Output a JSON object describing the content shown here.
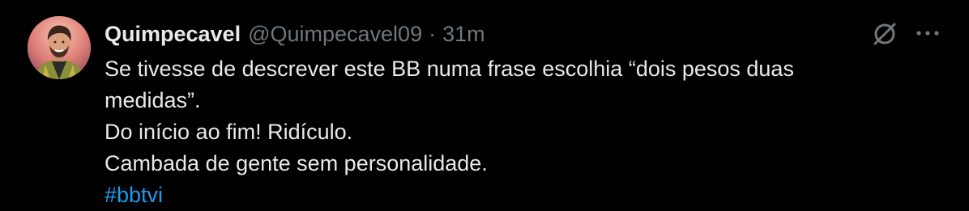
{
  "tweet": {
    "author": {
      "display_name": "Quimpecavel",
      "handle": "@Quimpecavel09",
      "separator": "·",
      "time": "31m"
    },
    "body_lines": [
      "Se tivesse de descrever este BB numa frase escolhia “dois pesos duas",
      "medidas”.",
      "Do início ao fim! Ridículo.",
      "Cambada de gente sem personalidade."
    ],
    "hashtag": "#bbtvi",
    "icons": {
      "avatar": "user-avatar",
      "grok": "grok-icon",
      "more": "more-options-icon"
    }
  },
  "colors": {
    "background": "#000000",
    "text_primary": "#e7e9ea",
    "text_secondary": "#71767b",
    "link": "#1d9bf0"
  }
}
